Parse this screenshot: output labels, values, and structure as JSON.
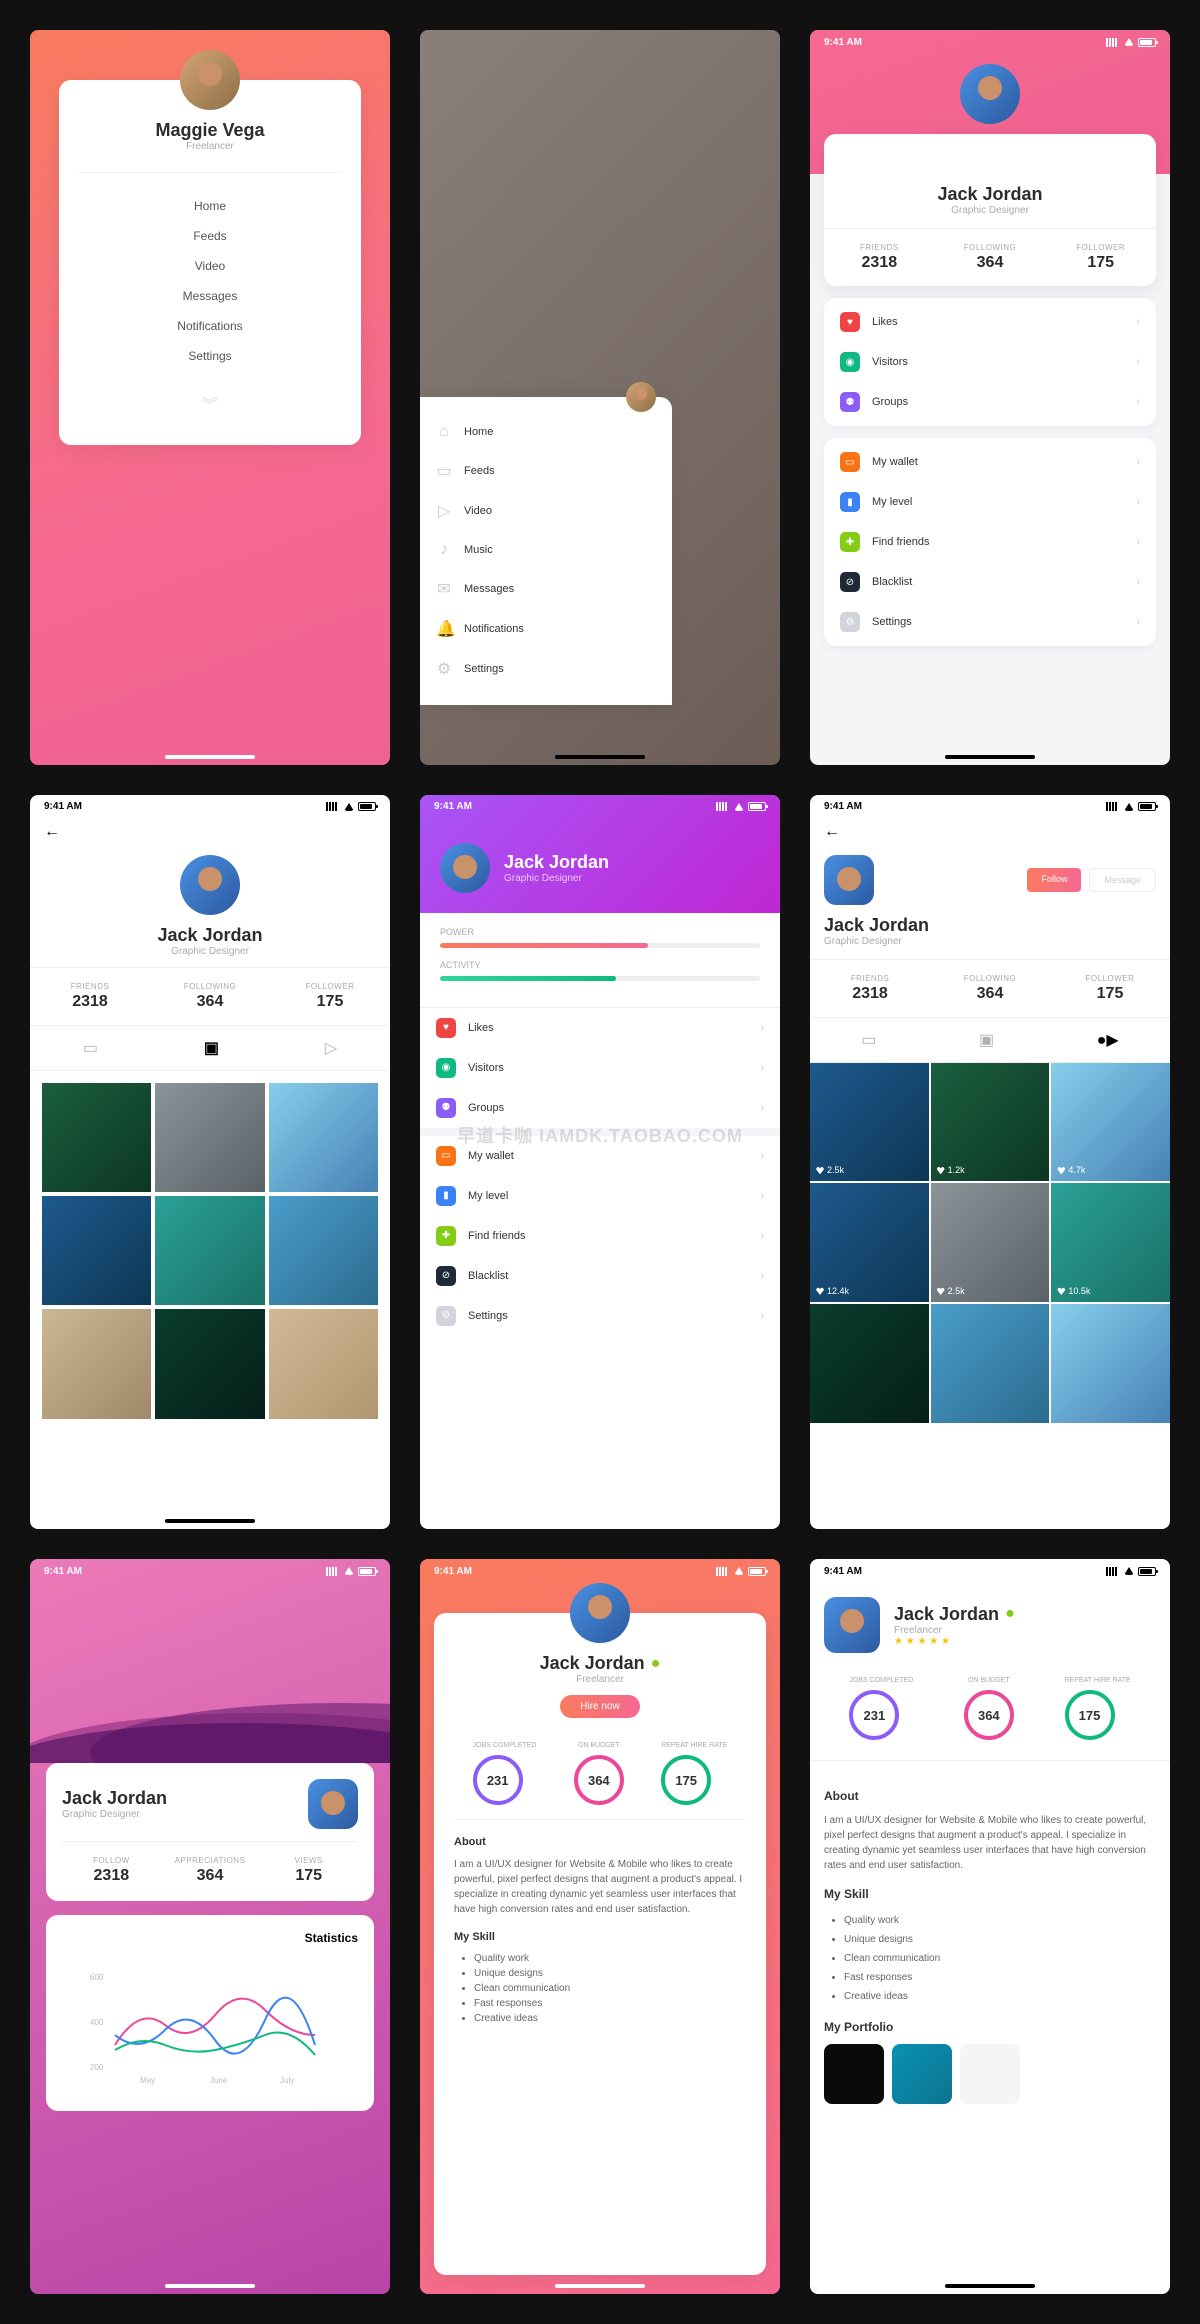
{
  "status_time": "9:41 AM",
  "watermark": "早道卡咖 IAMDK.TAOBAO.COM",
  "s1": {
    "name": "Maggie Vega",
    "role": "Freelancer",
    "menu": [
      "Home",
      "Feeds",
      "Video",
      "Messages",
      "Notifications",
      "Settings"
    ]
  },
  "s2": {
    "menu": [
      {
        "icon": "⌂",
        "label": "Home"
      },
      {
        "icon": "▭",
        "label": "Feeds"
      },
      {
        "icon": "▷",
        "label": "Video"
      },
      {
        "icon": "♪",
        "label": "Music"
      },
      {
        "icon": "✉",
        "label": "Messages"
      },
      {
        "icon": "🔔",
        "label": "Notifications"
      },
      {
        "icon": "⚙",
        "label": "Settings"
      }
    ]
  },
  "s3": {
    "name": "Jack Jordan",
    "role": "Graphic Designer",
    "stats": [
      {
        "label": "FRIENDS",
        "value": "2318"
      },
      {
        "label": "FOLLOWING",
        "value": "364"
      },
      {
        "label": "FOLLOWER",
        "value": "175"
      }
    ],
    "group1": [
      {
        "color": "#ef4444",
        "icon": "♥",
        "label": "Likes"
      },
      {
        "color": "#10b981",
        "icon": "◉",
        "label": "Visitors"
      },
      {
        "color": "#8b5cf6",
        "icon": "⚉",
        "label": "Groups"
      }
    ],
    "group2": [
      {
        "color": "#f97316",
        "icon": "▭",
        "label": "My wallet"
      },
      {
        "color": "#3b82f6",
        "icon": "▮",
        "label": "My level"
      },
      {
        "color": "#84cc16",
        "icon": "✚",
        "label": "Find friends"
      },
      {
        "color": "#1f2937",
        "icon": "⊘",
        "label": "Blacklist"
      },
      {
        "color": "#d1d5db",
        "icon": "⚙",
        "label": "Settings"
      }
    ]
  },
  "s4": {
    "name": "Jack Jordan",
    "role": "Graphic Designer",
    "stats": [
      {
        "label": "FRIENDS",
        "value": "2318"
      },
      {
        "label": "FOLLOWING",
        "value": "364"
      },
      {
        "label": "FOLLOWER",
        "value": "175"
      }
    ]
  },
  "s5": {
    "name": "Jack Jordan",
    "role": "Graphic Designer",
    "bars": [
      {
        "label": "POWER",
        "fill": 65,
        "gradient": "linear-gradient(90deg,#f97b5e,#f56991)"
      },
      {
        "label": "ACTIVITY",
        "fill": 55,
        "gradient": "linear-gradient(90deg,#34d399,#10b981)"
      }
    ],
    "group1": [
      {
        "color": "#ef4444",
        "icon": "♥",
        "label": "Likes"
      },
      {
        "color": "#10b981",
        "icon": "◉",
        "label": "Visitors"
      },
      {
        "color": "#8b5cf6",
        "icon": "⚉",
        "label": "Groups"
      }
    ],
    "group2": [
      {
        "color": "#f97316",
        "icon": "▭",
        "label": "My wallet"
      },
      {
        "color": "#3b82f6",
        "icon": "▮",
        "label": "My level"
      },
      {
        "color": "#84cc16",
        "icon": "✚",
        "label": "Find friends"
      },
      {
        "color": "#1f2937",
        "icon": "⊘",
        "label": "Blacklist"
      },
      {
        "color": "#d1d5db",
        "icon": "⚙",
        "label": "Settings"
      }
    ]
  },
  "s6": {
    "name": "Jack Jordan",
    "role": "Graphic Designer",
    "follow_btn": "Follow",
    "msg_btn": "Message",
    "stats": [
      {
        "label": "FRIENDS",
        "value": "2318"
      },
      {
        "label": "FOLLOWING",
        "value": "364"
      },
      {
        "label": "FOLLOWER",
        "value": "175"
      }
    ],
    "likes": [
      "2.5k",
      "1.2k",
      "4.7k",
      "12.4k",
      "2.5k",
      "10.5k"
    ]
  },
  "s7": {
    "name": "Jack Jordan",
    "role": "Graphic Designer",
    "stats": [
      {
        "label": "FOLLOW",
        "value": "2318"
      },
      {
        "label": "APPRECIATIONS",
        "value": "364"
      },
      {
        "label": "VIEWS",
        "value": "175"
      }
    ],
    "chart_title": "Statistics",
    "y_ticks": [
      "600",
      "400",
      "200"
    ],
    "x_ticks": [
      "May",
      "June",
      "July"
    ]
  },
  "s8": {
    "name": "Jack Jordan",
    "role": "Freelancer",
    "hire": "Hire now",
    "rings": [
      {
        "label": "JOBS COMPLETED",
        "value": "231",
        "color": "#8b5cf6"
      },
      {
        "label": "ON BUDGET",
        "value": "364",
        "color": "#ec4899"
      },
      {
        "label": "REPEAT HIRE RATE",
        "value": "175",
        "color": "#10b981"
      }
    ],
    "about_title": "About",
    "about": "I am a UI/UX designer for Website & Mobile who likes to create powerful, pixel perfect designs that augment a product's appeal. I specialize in creating dynamic yet seamless user interfaces that have high conversion rates and end user satisfaction.",
    "skill_title": "My Skill",
    "skills": [
      "Quality work",
      "Unique designs",
      "Clean communication",
      "Fast responses",
      "Creative ideas"
    ]
  },
  "s9": {
    "name": "Jack Jordan",
    "role": "Freelancer",
    "rings": [
      {
        "label": "JOBS COMPLETED",
        "value": "231",
        "color": "#8b5cf6"
      },
      {
        "label": "ON BUDGET",
        "value": "364",
        "color": "#ec4899"
      },
      {
        "label": "REPEAT HIRE RATE",
        "value": "175",
        "color": "#10b981"
      }
    ],
    "about_title": "About",
    "about": "I am a UI/UX designer for Website & Mobile who likes to create powerful, pixel perfect designs that augment a product's appeal. I specialize in creating dynamic yet seamless user interfaces that have high conversion rates and end user satisfaction.",
    "skill_title": "My Skill",
    "skills": [
      "Quality work",
      "Unique designs",
      "Clean communication",
      "Fast responses",
      "Creative ideas"
    ],
    "portfolio_title": "My Portfolio"
  }
}
